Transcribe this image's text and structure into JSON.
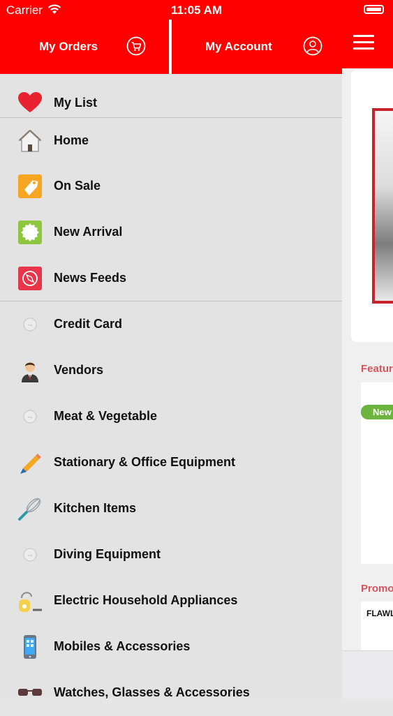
{
  "status_bar": {
    "carrier": "Carrier",
    "time": "11:05 AM"
  },
  "drawer": {
    "my_orders": "My Orders",
    "my_account": "My Account",
    "items": [
      {
        "label": "My List",
        "icon": "heart-icon"
      },
      {
        "label": "Home",
        "icon": "home-icon"
      },
      {
        "label": "On Sale",
        "icon": "sale-tag-icon"
      },
      {
        "label": "New Arrival",
        "icon": "new-badge-icon"
      },
      {
        "label": "News Feeds",
        "icon": "compass-icon"
      },
      {
        "label": "Credit Card",
        "icon": "placeholder-icon"
      },
      {
        "label": "Vendors",
        "icon": "vendor-person-icon"
      },
      {
        "label": "Meat & Vegetable",
        "icon": "placeholder-icon"
      },
      {
        "label": "Stationary & Office Equipment",
        "icon": "pencil-icon"
      },
      {
        "label": "Kitchen Items",
        "icon": "whisk-icon"
      },
      {
        "label": "Diving Equipment",
        "icon": "placeholder-icon"
      },
      {
        "label": "Electric Household Appliances",
        "icon": "vacuum-cleaner-icon"
      },
      {
        "label": "Mobiles & Accessories",
        "icon": "mobile-phone-icon"
      },
      {
        "label": "Watches, Glasses & Accessories",
        "icon": "glasses-icon"
      }
    ]
  },
  "main": {
    "featured_title": "Featur",
    "new_badge": "New",
    "promo_title": "Promo",
    "promo_text": "FLAWL"
  },
  "colors": {
    "brand_red": "#ff0000",
    "new_green": "#6db33f",
    "section_title": "#d9535f"
  }
}
